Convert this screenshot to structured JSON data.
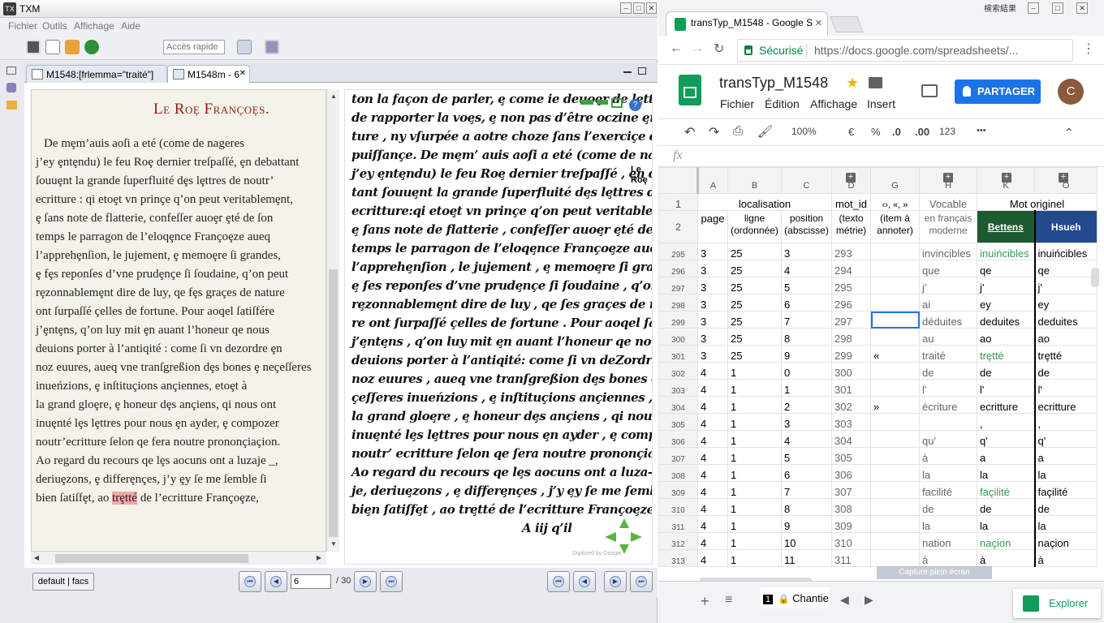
{
  "txm": {
    "title": "TXM",
    "menu": [
      "Fichier",
      "Outils",
      "Affichage",
      "Aide"
    ],
    "quick_access_placeholder": "Accès rapide",
    "tabs": [
      {
        "label": "M1548:[frlemma=\"traité\"]",
        "active": false
      },
      {
        "label": "M1548m - 6",
        "active": true,
        "close": "✕"
      }
    ],
    "text_view": {
      "heading": "Le Roȩ Françoȩs.",
      "lines": [
        "De mȩm’auis aoſi a eté (come de nageres",
        "j’ey ȩntȩndu) le feu Roȩ dernier treſpaſſé, ȩn debattant",
        "ſouuȩnt la grande ſuperfluité dȩs lȩttres de noutr’",
        "ecritture : qi etoȩt vn prinçe q’on peut veritablemȩnt,",
        "ȩ ſans note de flatterie, confeſſer auoȩr ȩté de ſon",
        "temps le parragon de l’eloqȩnce Françoȩze aueq",
        "l’apprehȩnſion, le jujement, ȩ memoȩre ſi grandes,",
        "ȩ fȩs reponſes d’vne prudȩnçe ſi ſoudaine, q’on peut",
        "rȩzonnablemȩnt dire de luy, qe fȩs graçes de nature",
        "ont ſurpaſſé çelles de fortune. Pour aoqel ſatiſfére",
        "j’ȩntȩns, q’on luy mit ȩn auant l’honeur qe nous",
        "deuions porter à l’antiqité : come ſi vn dezordre ȩn",
        "noz euures, aueq vne tranſgreßion dȩs bones ȩ neçeſſeres",
        "inueńzions, ȩ inſtituçions ançiennes, etoȩt à",
        "la grand gloȩre, ȩ honeur dȩs ançiens, qi nous ont",
        "inuȩnté lȩs lȩttres pour nous ȩn ayder, ȩ compozer",
        "noutr’ecritture ſelon qe fera noutre prononçiaçion.",
        "Ao regard du recours qe lȩs aocuns ont a luzaje _,",
        "deriuȩzons, ȩ differȩnçes, j’y ȩy ſe me ſemble ſi",
        "bien ſatiſfȩt, ao ",
        "trȩtté",
        " de l’ecritture Françoȩze,"
      ]
    },
    "image_view": {
      "lines": [
        "ton la façon de parler, ȩ come ie deuoȩr de lȩttres ȩt",
        "de rapporter la voȩs, ȩ non pas d’être oczine ȩn l’ecrit",
        "ture , ny vſurpée a aotre choze ſans l’exerciçe de ſa",
        "puiſſançe. De mȩm’ auis aoſi a eté (come de nageres",
        "j’ey ȩntȩndu) le feu Roȩ dernier treſpaſſé , ȩn debat-",
        "tant ſouuȩnt la grande ſuperfluité dȩs lȩttres de noutr’",
        "ecritture:qi etoȩt vn prinçe q’on peut veritablemȩnt,",
        "ȩ ſans note de flatterie , confeſſer auoȩr ȩté de ſon",
        "temps le parragon de l’eloqȩnce Françoȩze aueq",
        "l’apprehȩnſion , le jujement , ȩ memoȩre ſi grandes,",
        "ȩ ſes reponſes d’vne prudȩnçe ſi ſoudaine , q’on peut",
        "rȩzonnablemȩnt dire de luy , qe ſes graçes de natu-",
        "re ont ſurpaſſé çelles de fortune . Pour aoqel ſatiſfére",
        "j’ȩntȩns , q’on luy mit ȩn auant l’honeur qe nous",
        "deuions porter à l’antiqité: come ſi vn deZordre ȩn",
        "noz euures , aueq vne tranſgreßion dȩs bones ȩ ne-",
        "çeſſeres inueńzions , ȩ inſtituçions ançiennes , etoȩt à",
        "la grand gloȩre , ȩ honeur dȩs ançiens , qi nous ont",
        "inuȩnté lȩs lȩttres pour nous ȩn ayder , ȩ compozer",
        "noutr’ ecritture ſelon qe ſera noutre prononçiaçion .",
        "Ao regard du recours qe lȩs aocuns ont a luza-",
        "je, deriuȩzons , ȩ differȩnçes , j’y ȩy ſe me ſemble ſi",
        "biȩn ſatiſfȩt , ao trȩtté de l’ecritture Françoȩze ,",
        "A   iij             q’il"
      ],
      "margin_note": [
        "Le",
        "Roȩ"
      ],
      "watermark": "Digitized by Google"
    },
    "edition_button": "default | facs",
    "page_current": "6",
    "page_total": "/ 30"
  },
  "chrome": {
    "window_label": "検索結果",
    "tab_title": "transTyp_M1548 - Google S",
    "secure_label": "Sécurisé",
    "url": "https://docs.google.com/spreadsheets/..."
  },
  "sheets": {
    "doc_title": "transTyp_M1548",
    "menus": [
      "Fichier",
      "Édition",
      "Affichage",
      "Insert"
    ],
    "share_label": "PARTAGER",
    "avatar_letter": "C",
    "zoom": "100%",
    "toolbar": {
      "currency": "€",
      "percent": "%",
      "dec_minus": ".0",
      "dec_plus": ".00",
      "format": "123",
      "more": "•••"
    },
    "fx_label": "fx",
    "columns": [
      "A",
      "B",
      "C",
      "D",
      "G",
      "H",
      "K",
      "O"
    ],
    "header_row1": {
      "rownum": "1",
      "localisation": "localisation",
      "mot_id": "mot_id",
      "quotes": "‹›, «, »",
      "vocable": "Vocable",
      "mot_originel": "Mot originel"
    },
    "header_row2": {
      "rownum": "2",
      "page": "page",
      "ligne": "ligne (ordonnée)",
      "position": "position (abscisse)",
      "texto": "(texto métrie)",
      "item": "(item à annoter)",
      "vocable2": "en français moderne",
      "bettens": "Bettens",
      "hsueh": "Hsueh"
    },
    "rows": [
      {
        "n": "295",
        "a": "3",
        "b": "25",
        "c": "3",
        "d": "293",
        "g": "",
        "h": "invincibles",
        "k": "inuińcibles",
        "o": "inuińcibles",
        "k_green": true
      },
      {
        "n": "296",
        "a": "3",
        "b": "25",
        "c": "4",
        "d": "294",
        "g": "",
        "h": "que",
        "k": "qe",
        "o": "qe",
        "k_green": false
      },
      {
        "n": "297",
        "a": "3",
        "b": "25",
        "c": "5",
        "d": "295",
        "g": "",
        "h": "j'",
        "k": "j'",
        "o": "j'",
        "k_green": false
      },
      {
        "n": "298",
        "a": "3",
        "b": "25",
        "c": "6",
        "d": "296",
        "g": "",
        "h": "ai",
        "k": "ey",
        "o": "ey",
        "k_green": false
      },
      {
        "n": "299",
        "a": "3",
        "b": "25",
        "c": "7",
        "d": "297",
        "g": "",
        "h": "déduites",
        "k": "deduites",
        "o": "deduites",
        "k_green": false
      },
      {
        "n": "300",
        "a": "3",
        "b": "25",
        "c": "8",
        "d": "298",
        "g": "",
        "h": "au",
        "k": "ao",
        "o": "ao",
        "k_green": false
      },
      {
        "n": "301",
        "a": "3",
        "b": "25",
        "c": "9",
        "d": "299",
        "g": "«",
        "h": "traité",
        "k": "trȩtté",
        "o": "trȩtté",
        "k_green": true
      },
      {
        "n": "302",
        "a": "4",
        "b": "1",
        "c": "0",
        "d": "300",
        "g": "",
        "h": "de",
        "k": "de",
        "o": "de",
        "k_green": false
      },
      {
        "n": "303",
        "a": "4",
        "b": "1",
        "c": "1",
        "d": "301",
        "g": "",
        "h": "l'",
        "k": "l'",
        "o": "l'",
        "k_green": false
      },
      {
        "n": "304",
        "a": "4",
        "b": "1",
        "c": "2",
        "d": "302",
        "g": "»",
        "h": "écriture",
        "k": "ecritture",
        "o": "ecritture",
        "k_green": false
      },
      {
        "n": "305",
        "a": "4",
        "b": "1",
        "c": "3",
        "d": "303",
        "g": "",
        "h": "",
        "k": ",",
        "o": ",",
        "k_green": false
      },
      {
        "n": "306",
        "a": "4",
        "b": "1",
        "c": "4",
        "d": "304",
        "g": "",
        "h": "qu'",
        "k": "q'",
        "o": "q'",
        "k_green": false
      },
      {
        "n": "307",
        "a": "4",
        "b": "1",
        "c": "5",
        "d": "305",
        "g": "",
        "h": "à",
        "k": "a",
        "o": "a",
        "k_green": false
      },
      {
        "n": "308",
        "a": "4",
        "b": "1",
        "c": "6",
        "d": "306",
        "g": "",
        "h": "la",
        "k": "la",
        "o": "la",
        "k_green": false
      },
      {
        "n": "309",
        "a": "4",
        "b": "1",
        "c": "7",
        "d": "307",
        "g": "",
        "h": "facilité",
        "k": "façilité",
        "o": "façilité",
        "k_green": true
      },
      {
        "n": "310",
        "a": "4",
        "b": "1",
        "c": "8",
        "d": "308",
        "g": "",
        "h": "de",
        "k": "de",
        "o": "de",
        "k_green": false
      },
      {
        "n": "311",
        "a": "4",
        "b": "1",
        "c": "9",
        "d": "309",
        "g": "",
        "h": "la",
        "k": "la",
        "o": "la",
        "k_green": false
      },
      {
        "n": "312",
        "a": "4",
        "b": "1",
        "c": "10",
        "d": "310",
        "g": "",
        "h": "nation",
        "k": "naçion",
        "o": "naçion",
        "k_green": true
      },
      {
        "n": "313",
        "a": "4",
        "b": "1",
        "c": "11",
        "d": "311",
        "g": "",
        "h": "à",
        "k": "à",
        "o": "à",
        "k_green": false
      }
    ],
    "sheet_tab_number": "1",
    "sheet_tab_label": "Chantie",
    "explorer_label": "Explorer",
    "capture_label": "Capture plein écran",
    "colors": {
      "bettens_bg": "#1e5a2f",
      "hsueh_bg": "#234a8c",
      "green_text": "#2e9e4f",
      "share_blue": "#1a73e8"
    }
  }
}
